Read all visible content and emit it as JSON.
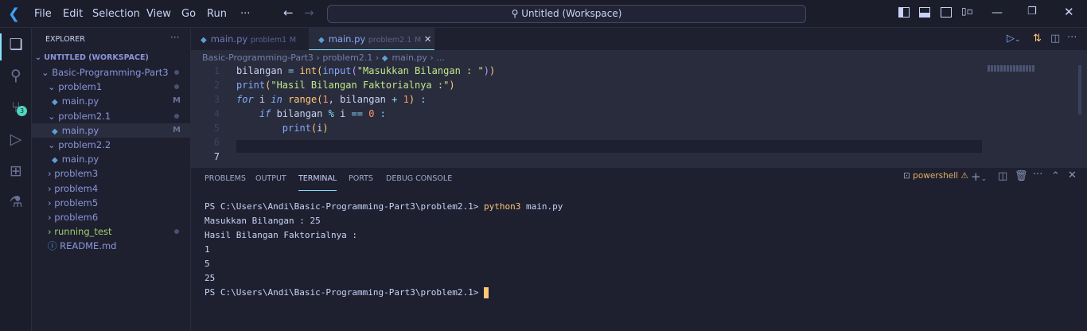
{
  "titlebar": {
    "menus": [
      "File",
      "Edit",
      "Selection",
      "View",
      "Go",
      "Run",
      "···"
    ],
    "search": "Untitled (Workspace)"
  },
  "activity": {
    "scm_badge": "3"
  },
  "sidebar": {
    "title": "EXPLORER",
    "workspace": "UNTITLED (WORKSPACE)",
    "items": [
      {
        "label": "Basic-Programming-Part3",
        "type": "folder-open",
        "indent": 1,
        "status": "dot"
      },
      {
        "label": "problem1",
        "type": "folder-open",
        "indent": 2,
        "status": "dot"
      },
      {
        "label": "main.py",
        "type": "file",
        "indent": 3,
        "status": "M"
      },
      {
        "label": "problem2.1",
        "type": "folder-open",
        "indent": 2,
        "status": "dot"
      },
      {
        "label": "main.py",
        "type": "file",
        "indent": 3,
        "status": "M",
        "selected": true
      },
      {
        "label": "problem2.2",
        "type": "folder-open",
        "indent": 2
      },
      {
        "label": "main.py",
        "type": "file",
        "indent": 3
      },
      {
        "label": "problem3",
        "type": "folder",
        "indent": 2
      },
      {
        "label": "problem4",
        "type": "folder",
        "indent": 2
      },
      {
        "label": "problem5",
        "type": "folder",
        "indent": 2
      },
      {
        "label": "problem6",
        "type": "folder",
        "indent": 2
      },
      {
        "label": "running_test",
        "type": "folder",
        "indent": 2,
        "status": "dot",
        "color": "#9ece6a"
      },
      {
        "label": "README.md",
        "type": "info",
        "indent": 2
      }
    ]
  },
  "tabs": [
    {
      "name": "main.py",
      "folder": "problem1",
      "status": "M"
    },
    {
      "name": "main.py",
      "folder": "problem2.1",
      "status": "M",
      "active": true
    }
  ],
  "breadcrumb": [
    "Basic-Programming-Part3",
    "problem2.1",
    "main.py",
    "..."
  ],
  "code": {
    "line_numbers": [
      "1",
      "2",
      "3",
      "4",
      "5",
      "6",
      "7"
    ],
    "active_line": 7
  },
  "panel": {
    "tabs": [
      "PROBLEMS",
      "OUTPUT",
      "TERMINAL",
      "PORTS",
      "DEBUG CONSOLE"
    ],
    "active": "TERMINAL",
    "shell": "powershell",
    "terminal": {
      "prompt": "PS C:\\Users\\Andi\\Basic-Programming-Part3\\problem2.1> ",
      "command": "python3",
      "args": " main.py",
      "output": [
        "Masukkan Bilangan : 25",
        "Hasil Bilangan Faktorialnya :",
        "1",
        "5",
        "25"
      ]
    }
  },
  "colors": {
    "accent": "#86e1fc",
    "cursor": "#ffc777",
    "badge": "#4fd6be"
  }
}
